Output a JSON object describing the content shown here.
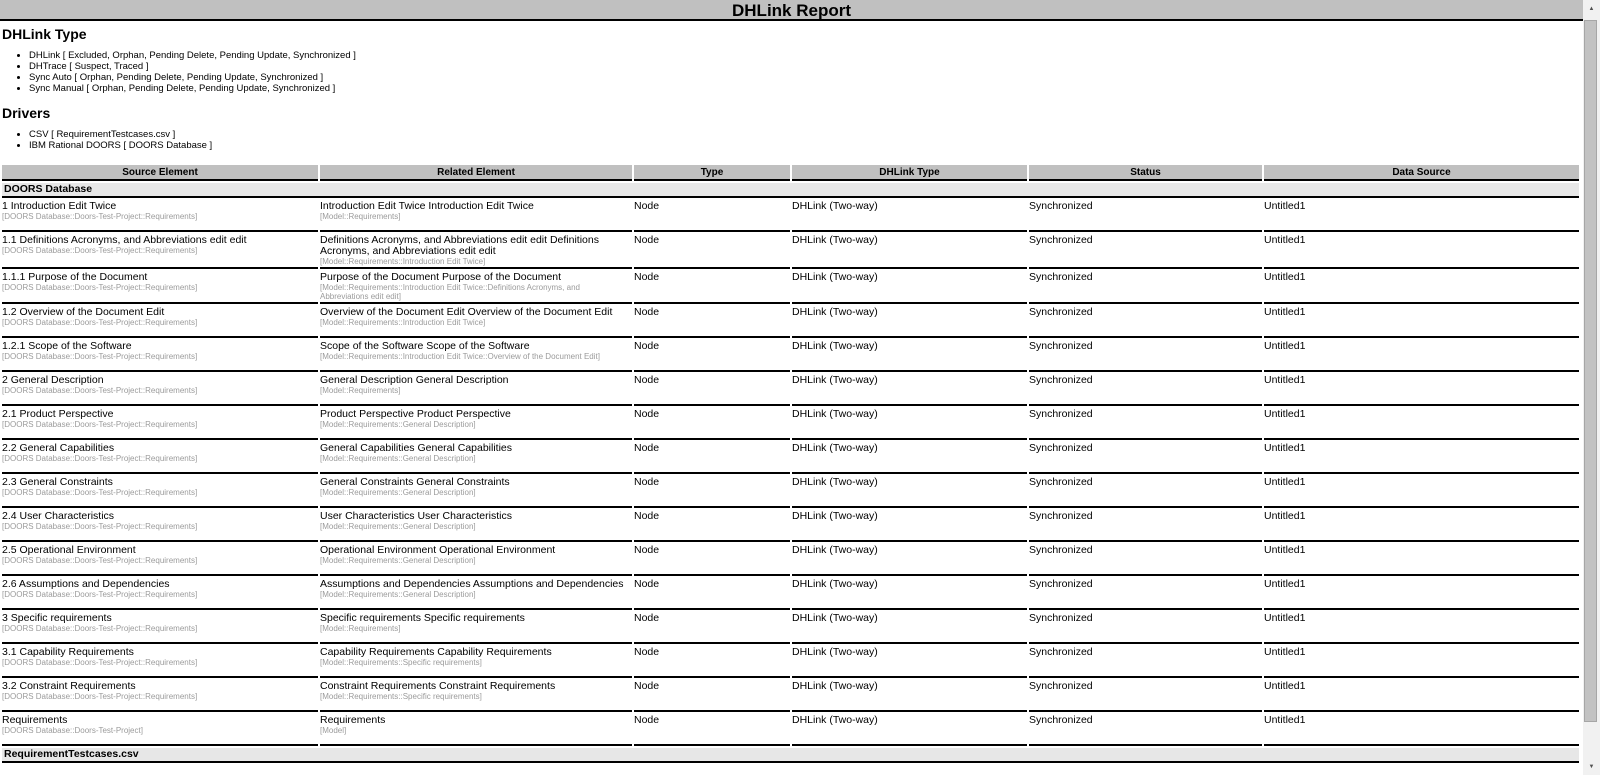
{
  "title": "DHLink Report",
  "dhlink_type": {
    "heading": "DHLink Type",
    "items": [
      "DHLink [ Excluded, Orphan, Pending Delete, Pending Update, Synchronized ]",
      "DHTrace [ Suspect, Traced ]",
      "Sync Auto [ Orphan, Pending Delete, Pending Update, Synchronized ]",
      "Sync Manual [ Orphan, Pending Delete, Pending Update, Synchronized ]"
    ]
  },
  "drivers": {
    "heading": "Drivers",
    "items": [
      "CSV [ RequirementTestcases.csv ]",
      "IBM Rational DOORS [ DOORS Database ]"
    ]
  },
  "table": {
    "columns": [
      "Source Element",
      "Related Element",
      "Type",
      "DHLink Type",
      "Status",
      "Data Source"
    ],
    "groups": [
      {
        "name": "DOORS Database",
        "rows": [
          {
            "source": "1 Introduction Edit Twice",
            "source_path": "[DOORS Database::Doors-Test-Project::Requirements]",
            "related": "Introduction Edit Twice Introduction Edit Twice",
            "related_path": "[Model::Requirements]",
            "type": "Node",
            "dhlink_type": "DHLink (Two-way)",
            "status": "Synchronized",
            "data_source": "Untitled1"
          },
          {
            "source": "1.1 Definitions Acronyms, and Abbreviations edit edit",
            "source_path": "[DOORS Database::Doors-Test-Project::Requirements]",
            "related": "Definitions Acronyms, and Abbreviations edit edit Definitions Acronyms, and Abbreviations edit edit",
            "related_path": "[Model::Requirements::Introduction Edit Twice]",
            "type": "Node",
            "dhlink_type": "DHLink (Two-way)",
            "status": "Synchronized",
            "data_source": "Untitled1"
          },
          {
            "source": "1.1.1 Purpose of the Document",
            "source_path": "[DOORS Database::Doors-Test-Project::Requirements]",
            "related": "Purpose of the Document Purpose of the Document",
            "related_path": "[Model::Requirements::Introduction Edit Twice::Definitions Acronyms, and Abbreviations edit edit]",
            "type": "Node",
            "dhlink_type": "DHLink (Two-way)",
            "status": "Synchronized",
            "data_source": "Untitled1"
          },
          {
            "source": "1.2 Overview of the Document Edit",
            "source_path": "[DOORS Database::Doors-Test-Project::Requirements]",
            "related": "Overview of the Document Edit Overview of the Document Edit",
            "related_path": "[Model::Requirements::Introduction Edit Twice]",
            "type": "Node",
            "dhlink_type": "DHLink (Two-way)",
            "status": "Synchronized",
            "data_source": "Untitled1"
          },
          {
            "source": "1.2.1 Scope of the Software",
            "source_path": "[DOORS Database::Doors-Test-Project::Requirements]",
            "related": "Scope of the Software Scope of the Software",
            "related_path": "[Model::Requirements::Introduction Edit Twice::Overview of the Document Edit]",
            "type": "Node",
            "dhlink_type": "DHLink (Two-way)",
            "status": "Synchronized",
            "data_source": "Untitled1"
          },
          {
            "source": "2 General Description",
            "source_path": "[DOORS Database::Doors-Test-Project::Requirements]",
            "related": "General Description General Description",
            "related_path": "[Model::Requirements]",
            "type": "Node",
            "dhlink_type": "DHLink (Two-way)",
            "status": "Synchronized",
            "data_source": "Untitled1"
          },
          {
            "source": "2.1 Product Perspective",
            "source_path": "[DOORS Database::Doors-Test-Project::Requirements]",
            "related": "Product Perspective Product Perspective",
            "related_path": "[Model::Requirements::General Description]",
            "type": "Node",
            "dhlink_type": "DHLink (Two-way)",
            "status": "Synchronized",
            "data_source": "Untitled1"
          },
          {
            "source": "2.2 General Capabilities",
            "source_path": "[DOORS Database::Doors-Test-Project::Requirements]",
            "related": "General Capabilities General Capabilities",
            "related_path": "[Model::Requirements::General Description]",
            "type": "Node",
            "dhlink_type": "DHLink (Two-way)",
            "status": "Synchronized",
            "data_source": "Untitled1"
          },
          {
            "source": "2.3 General Constraints",
            "source_path": "[DOORS Database::Doors-Test-Project::Requirements]",
            "related": "General Constraints General Constraints",
            "related_path": "[Model::Requirements::General Description]",
            "type": "Node",
            "dhlink_type": "DHLink (Two-way)",
            "status": "Synchronized",
            "data_source": "Untitled1"
          },
          {
            "source": "2.4 User Characteristics",
            "source_path": "[DOORS Database::Doors-Test-Project::Requirements]",
            "related": "User Characteristics User Characteristics",
            "related_path": "[Model::Requirements::General Description]",
            "type": "Node",
            "dhlink_type": "DHLink (Two-way)",
            "status": "Synchronized",
            "data_source": "Untitled1"
          },
          {
            "source": "2.5 Operational Environment",
            "source_path": "[DOORS Database::Doors-Test-Project::Requirements]",
            "related": "Operational Environment Operational Environment",
            "related_path": "[Model::Requirements::General Description]",
            "type": "Node",
            "dhlink_type": "DHLink (Two-way)",
            "status": "Synchronized",
            "data_source": "Untitled1"
          },
          {
            "source": "2.6 Assumptions and Dependencies",
            "source_path": "[DOORS Database::Doors-Test-Project::Requirements]",
            "related": "Assumptions and Dependencies Assumptions and Dependencies",
            "related_path": "[Model::Requirements::General Description]",
            "type": "Node",
            "dhlink_type": "DHLink (Two-way)",
            "status": "Synchronized",
            "data_source": "Untitled1"
          },
          {
            "source": "3 Specific requirements",
            "source_path": "[DOORS Database::Doors-Test-Project::Requirements]",
            "related": "Specific requirements Specific requirements",
            "related_path": "[Model::Requirements]",
            "type": "Node",
            "dhlink_type": "DHLink (Two-way)",
            "status": "Synchronized",
            "data_source": "Untitled1"
          },
          {
            "source": "3.1 Capability Requirements",
            "source_path": "[DOORS Database::Doors-Test-Project::Requirements]",
            "related": "Capability Requirements Capability Requirements",
            "related_path": "[Model::Requirements::Specific requirements]",
            "type": "Node",
            "dhlink_type": "DHLink (Two-way)",
            "status": "Synchronized",
            "data_source": "Untitled1"
          },
          {
            "source": "3.2 Constraint Requirements",
            "source_path": "[DOORS Database::Doors-Test-Project::Requirements]",
            "related": "Constraint Requirements Constraint Requirements",
            "related_path": "[Model::Requirements::Specific requirements]",
            "type": "Node",
            "dhlink_type": "DHLink (Two-way)",
            "status": "Synchronized",
            "data_source": "Untitled1"
          },
          {
            "source": "Requirements",
            "source_path": "[DOORS Database::Doors-Test-Project]",
            "related": "Requirements",
            "related_path": "[Model]",
            "type": "Node",
            "dhlink_type": "DHLink (Two-way)",
            "status": "Synchronized",
            "data_source": "Untitled1"
          }
        ]
      },
      {
        "name": "RequirementTestcases.csv",
        "rows": []
      }
    ]
  },
  "scrollbar": {
    "up_glyph": "▲",
    "down_glyph": "▼"
  },
  "colors": {
    "titlebar_bg": "#c0c0c0",
    "column_header_bg": "#c0c0c0",
    "group_row_bg": "#e7e7e7",
    "row_border": "#000000",
    "muted_text": "#9b9b9b"
  }
}
